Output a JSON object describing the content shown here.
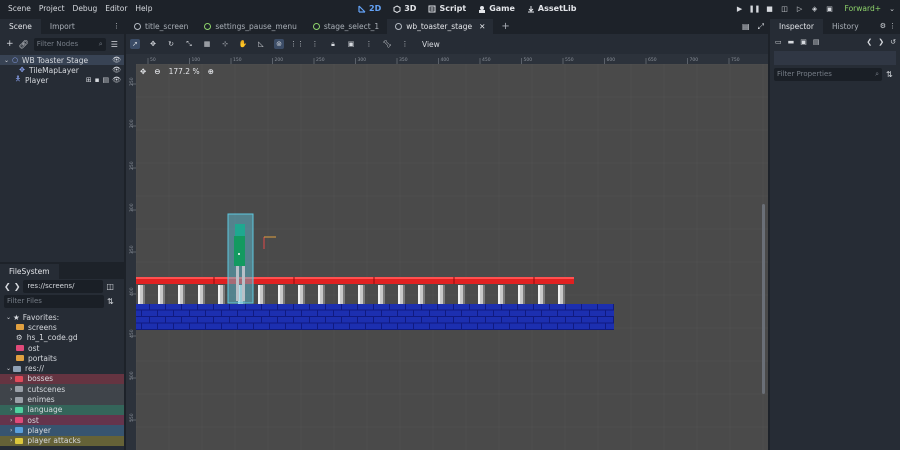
{
  "menu": [
    "Scene",
    "Project",
    "Debug",
    "Editor",
    "Help"
  ],
  "main_modes": [
    {
      "label": "2D",
      "icon": "2d-icon",
      "active": true
    },
    {
      "label": "3D",
      "icon": "3d-icon",
      "active": false
    },
    {
      "label": "Script",
      "icon": "script-icon",
      "active": false
    },
    {
      "label": "Game",
      "icon": "game-icon",
      "active": false
    },
    {
      "label": "AssetLib",
      "icon": "assetlib-icon",
      "active": false
    }
  ],
  "renderer": "Forward+",
  "left_dock": {
    "tabs": [
      "Scene",
      "Import"
    ],
    "filter_placeholder": "Filter Nodes",
    "tree": [
      {
        "label": "WB Toaster Stage",
        "icon": "node2d-icon",
        "selected": true
      },
      {
        "label": "TileMapLayer",
        "icon": "tilemap-icon",
        "selected": false
      },
      {
        "label": "Player",
        "icon": "character-icon",
        "selected": false
      }
    ]
  },
  "filesystem": {
    "tab": "FileSystem",
    "path": "res://screens/",
    "filter_placeholder": "Filter Files",
    "favorites_label": "Favorites:",
    "favorites": [
      {
        "label": "screens",
        "color": "#e0a040"
      },
      {
        "label": "hs_1_code.gd",
        "color": "#d6d9de"
      },
      {
        "label": "ost",
        "color": "#e04a7a"
      },
      {
        "label": "portaits",
        "color": "#e0a040"
      }
    ],
    "root_label": "res://",
    "folders": [
      {
        "label": "bosses",
        "color": "#e04a5a",
        "hl": "hl-red"
      },
      {
        "label": "cutscenes",
        "color": "#9aa0a8",
        "hl": "hl-gray"
      },
      {
        "label": "enimes",
        "color": "#9aa0a8",
        "hl": "hl-gray"
      },
      {
        "label": "language",
        "color": "#50d2a0",
        "hl": "hl-green"
      },
      {
        "label": "ost",
        "color": "#e04a7a",
        "hl": "hl-pink"
      },
      {
        "label": "player",
        "color": "#5aa0dc",
        "hl": "hl-blue"
      },
      {
        "label": "player attacks",
        "color": "#dcc83c",
        "hl": "hl-yellow"
      }
    ]
  },
  "scene_tabs": [
    {
      "label": "title_screen",
      "active": false
    },
    {
      "label": "settings_pause_menu",
      "active": false
    },
    {
      "label": "stage_select_1",
      "active": false
    },
    {
      "label": "wb_toaster_stage",
      "active": true
    }
  ],
  "view_menu": "View",
  "zoom": "177.2 %",
  "ruler_top": [
    "50",
    "100",
    "150",
    "200",
    "250",
    "300",
    "350",
    "400",
    "450",
    "500",
    "550",
    "600",
    "650",
    "700",
    "750"
  ],
  "ruler_left": [
    "250",
    "200",
    "250",
    "300",
    "350",
    "400",
    "450",
    "500",
    "550"
  ],
  "inspector": {
    "tabs": [
      "Inspector",
      "History"
    ],
    "filter_placeholder": "Filter Properties"
  },
  "colors": {
    "accent": "#64a3f7",
    "renderer": "#8ed36b",
    "viewport_bg": "#4a4a4a",
    "platform_red": "#e02020",
    "brick_blue": "#1c2fb0",
    "selection": "#5fc8e0"
  }
}
